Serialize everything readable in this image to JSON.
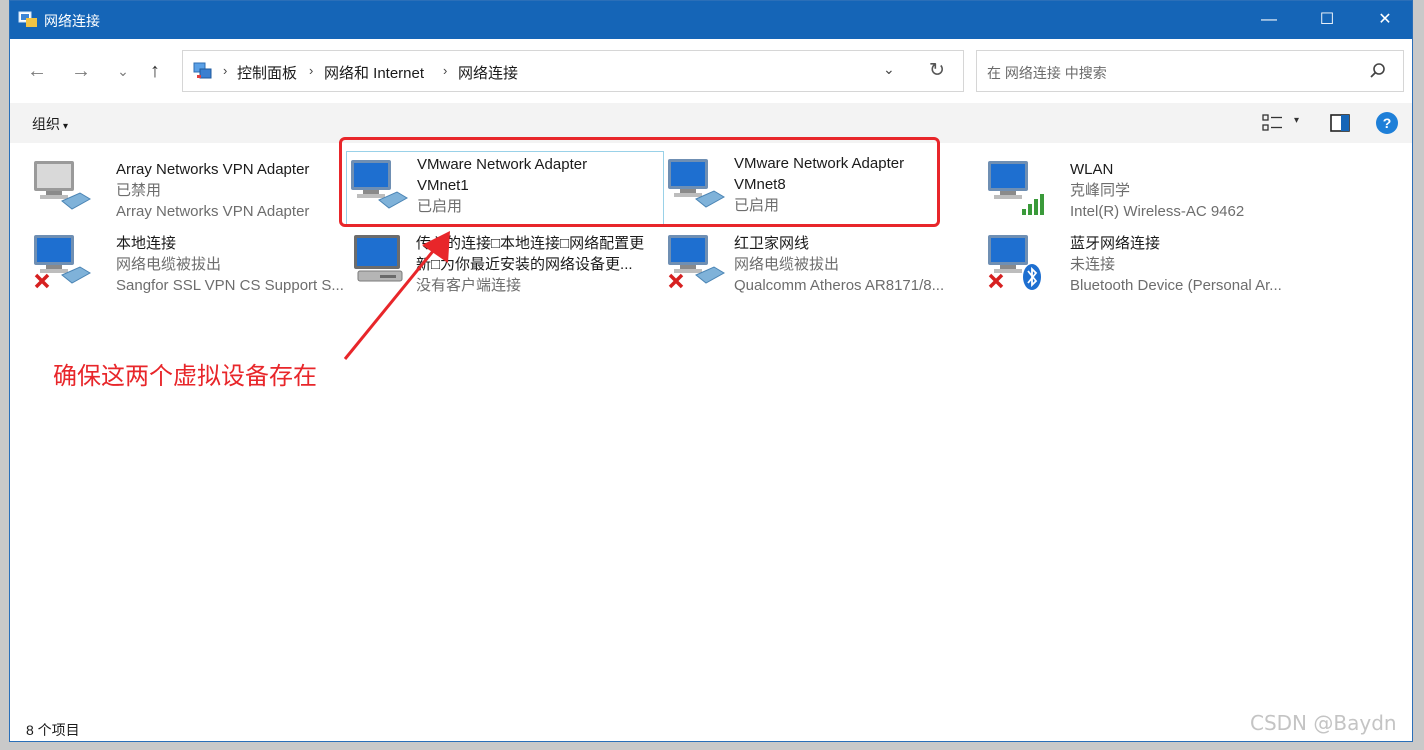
{
  "window": {
    "title": "网络连接",
    "minimize_label": "—",
    "maximize_label": "☐",
    "close_label": "✕"
  },
  "nav": {
    "back_label": "←",
    "forward_label": "→",
    "recent_label": "⌄",
    "up_label": "↑"
  },
  "address": {
    "crumbs": [
      "控制面板",
      "网络和 Internet",
      "网络连接"
    ],
    "separator": "›",
    "dropdown_label": "⌄",
    "refresh_label": "↻"
  },
  "search": {
    "placeholder": "在 网络连接 中搜索"
  },
  "toolbar": {
    "organize_label": "组织",
    "organize_caret": "▾",
    "view_dd_label": "▾",
    "help_label": "?"
  },
  "items": [
    {
      "name": "Array Networks VPN Adapter",
      "line2": "已禁用",
      "line3": "Array Networks VPN Adapter",
      "status_icon": "none"
    },
    {
      "name": "VMware Network Adapter",
      "line2": "VMnet1",
      "line3": "已启用",
      "status_icon": "none"
    },
    {
      "name": "VMware Network Adapter",
      "line2": "VMnet8",
      "line3": "已启用",
      "status_icon": "none"
    },
    {
      "name": "WLAN",
      "line2": "克峰同学",
      "line3": "Intel(R) Wireless-AC 9462",
      "status_icon": "signal"
    },
    {
      "name": "本地连接",
      "line2": "网络电缆被拔出",
      "line3": "Sangfor SSL VPN CS Support S...",
      "status_icon": "error"
    },
    {
      "name": "传入的连接□本地连接□网络配置更",
      "line2": "新□为你最近安装的网络设备更...",
      "line3": "没有客户端连接",
      "status_icon": "none"
    },
    {
      "name": "红卫家网线",
      "line2": "网络电缆被拔出",
      "line3": "Qualcomm Atheros AR8171/8...",
      "status_icon": "error"
    },
    {
      "name": "蓝牙网络连接",
      "line2": "未连接",
      "line3": "Bluetooth Device (Personal Ar...",
      "status_icon": "bluetooth-error"
    }
  ],
  "annotation": {
    "text": "确保这两个虚拟设备存在",
    "color": "#e8262a"
  },
  "status": {
    "count_text": "8 个项目"
  },
  "watermark": "CSDN @Baydn",
  "colors": {
    "titlebar": "#1565b7",
    "accent": "#1e7fd8",
    "highlight": "#e8262a"
  }
}
